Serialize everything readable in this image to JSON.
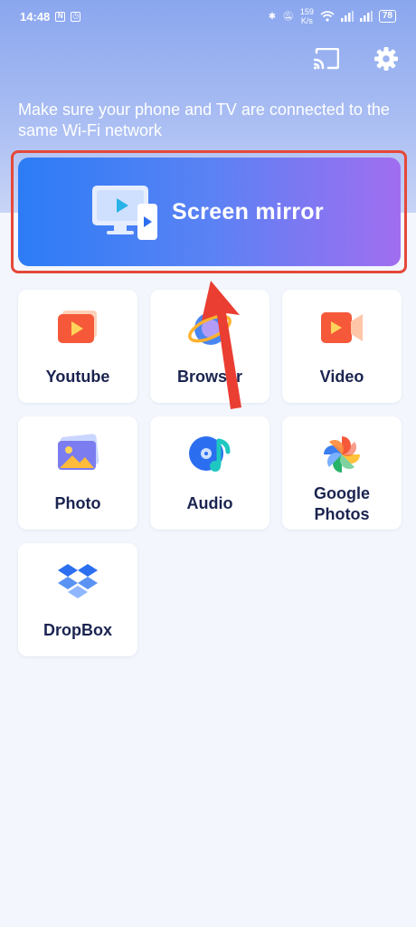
{
  "status_bar": {
    "time": "14:48",
    "net_speed_value": "159",
    "net_speed_unit": "K/s",
    "battery": "78"
  },
  "header": {
    "hint": "Make sure your phone and TV are connected to the same Wi-Fi network",
    "cast_icon": "cast-icon",
    "settings_icon": "gear-icon"
  },
  "mirror": {
    "label": "Screen mirror",
    "icon": "screen-mirror-icon"
  },
  "tiles": [
    {
      "label": "Youtube",
      "icon": "youtube-icon"
    },
    {
      "label": "Browser",
      "icon": "browser-icon"
    },
    {
      "label": "Video",
      "icon": "video-icon"
    },
    {
      "label": "Photo",
      "icon": "photo-icon"
    },
    {
      "label": "Audio",
      "icon": "audio-icon"
    },
    {
      "label_line1": "Google",
      "label_line2": "Photos",
      "icon": "google-photos-icon"
    },
    {
      "label": "DropBox",
      "icon": "dropbox-icon"
    }
  ],
  "colors": {
    "accent_start": "#2c7cf6",
    "accent_end": "#a06ef0",
    "highlight_red": "#e5483a",
    "text_dark": "#1b2450"
  }
}
